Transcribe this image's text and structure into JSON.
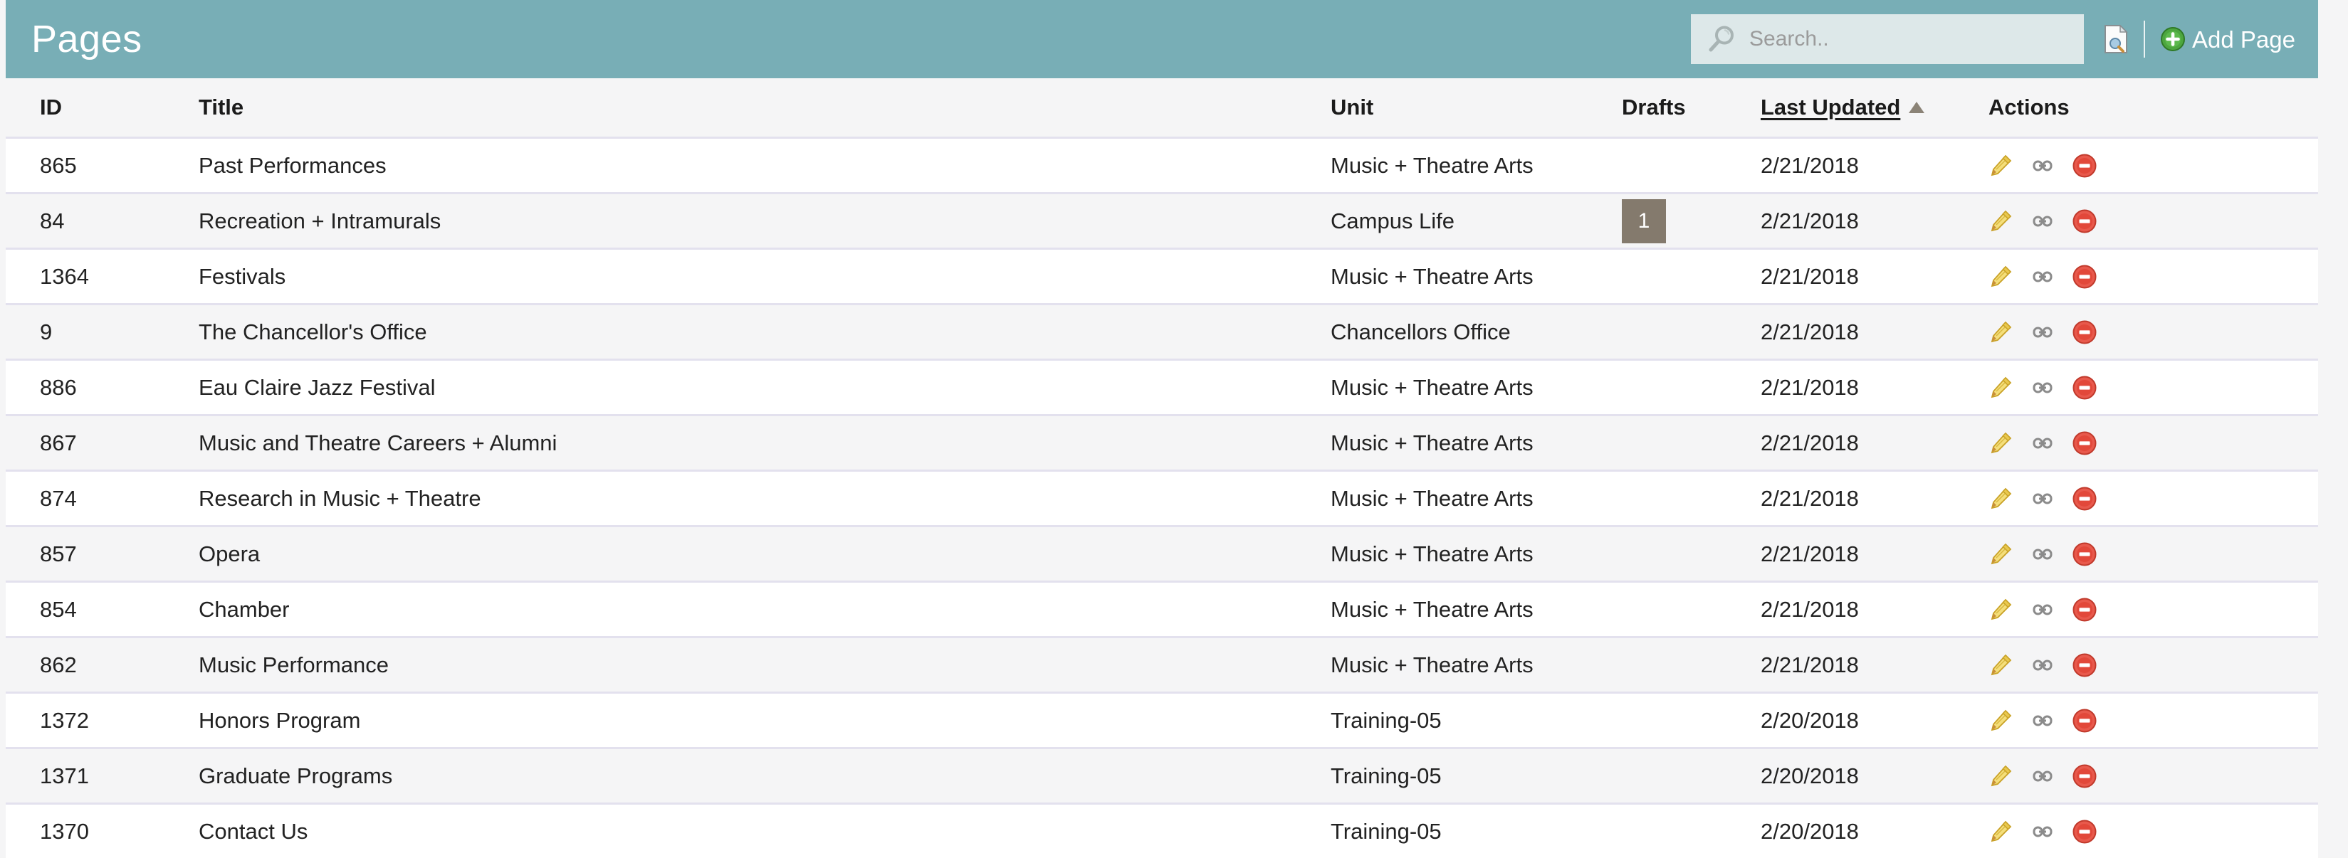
{
  "header": {
    "title": "Pages",
    "search": {
      "placeholder": "Search..",
      "value": "",
      "icon": "search-icon"
    },
    "copy_page_icon": "page-copy-icon",
    "add_page": {
      "label": "Add Page",
      "icon": "plus-circle-icon"
    },
    "accent_color": "#78aeb6",
    "search_bg_color": "#dde8e9"
  },
  "table": {
    "columns": [
      {
        "key": "id",
        "label": "ID",
        "sortable": true,
        "sorted": false
      },
      {
        "key": "title",
        "label": "Title",
        "sortable": true,
        "sorted": false
      },
      {
        "key": "unit",
        "label": "Unit",
        "sortable": true,
        "sorted": false
      },
      {
        "key": "drafts",
        "label": "Drafts",
        "sortable": true,
        "sorted": false
      },
      {
        "key": "last_updated",
        "label": "Last Updated",
        "sortable": true,
        "sorted": true,
        "sort_direction": "ascending",
        "sort_arrow": "triangle-up-icon"
      },
      {
        "key": "actions",
        "label": "Actions",
        "sortable": false,
        "sorted": false
      }
    ],
    "row_actions": [
      {
        "name": "edit-icon",
        "title": "Edit"
      },
      {
        "name": "link-icon",
        "title": "Link"
      },
      {
        "name": "delete-icon",
        "title": "Delete"
      }
    ],
    "rows": [
      {
        "id": "865",
        "title": "Past Performances",
        "unit": "Music + Theatre Arts",
        "drafts": "",
        "last_updated": "2/21/2018"
      },
      {
        "id": "84",
        "title": "Recreation + Intramurals",
        "unit": "Campus Life",
        "drafts": "1",
        "last_updated": "2/21/2018"
      },
      {
        "id": "1364",
        "title": "Festivals",
        "unit": "Music + Theatre Arts",
        "drafts": "",
        "last_updated": "2/21/2018"
      },
      {
        "id": "9",
        "title": "The Chancellor's Office",
        "unit": "Chancellors Office",
        "drafts": "",
        "last_updated": "2/21/2018"
      },
      {
        "id": "886",
        "title": "Eau Claire Jazz Festival",
        "unit": "Music + Theatre Arts",
        "drafts": "",
        "last_updated": "2/21/2018"
      },
      {
        "id": "867",
        "title": "Music and Theatre Careers + Alumni",
        "unit": "Music + Theatre Arts",
        "drafts": "",
        "last_updated": "2/21/2018"
      },
      {
        "id": "874",
        "title": "Research in Music + Theatre",
        "unit": "Music + Theatre Arts",
        "drafts": "",
        "last_updated": "2/21/2018"
      },
      {
        "id": "857",
        "title": "Opera",
        "unit": "Music + Theatre Arts",
        "drafts": "",
        "last_updated": "2/21/2018"
      },
      {
        "id": "854",
        "title": "Chamber",
        "unit": "Music + Theatre Arts",
        "drafts": "",
        "last_updated": "2/21/2018"
      },
      {
        "id": "862",
        "title": "Music Performance",
        "unit": "Music + Theatre Arts",
        "drafts": "",
        "last_updated": "2/21/2018"
      },
      {
        "id": "1372",
        "title": "Honors Program",
        "unit": "Training-05",
        "drafts": "",
        "last_updated": "2/20/2018"
      },
      {
        "id": "1371",
        "title": "Graduate Programs",
        "unit": "Training-05",
        "drafts": "",
        "last_updated": "2/20/2018"
      },
      {
        "id": "1370",
        "title": "Contact Us",
        "unit": "Training-05",
        "drafts": "",
        "last_updated": "2/20/2018"
      }
    ]
  },
  "colors": {
    "badge_bg": "#847a6d",
    "row_border": "#e3e1ee",
    "delete_red": "#e04a3f",
    "edit_yellow": "#f0cf4a",
    "add_green": "#4da63f"
  }
}
